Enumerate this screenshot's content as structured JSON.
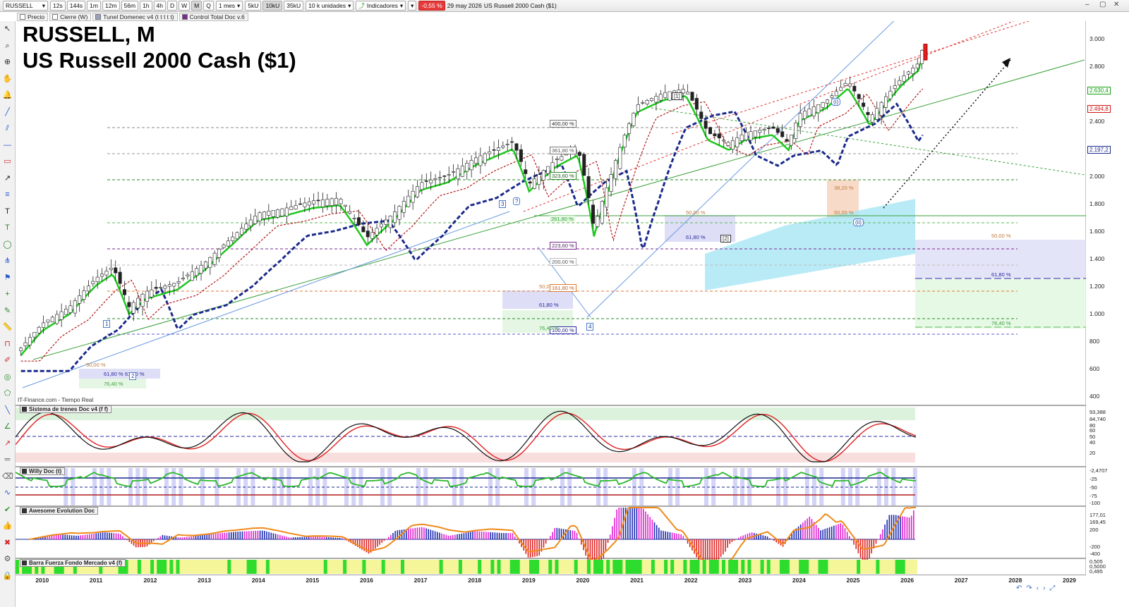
{
  "toolbar": {
    "symbol": "RUSSELL",
    "periods": [
      "12s",
      "144s",
      "1m",
      "12m",
      "56m",
      "1h",
      "4h",
      "D",
      "W",
      "M",
      "Q"
    ],
    "active_period": "M",
    "range": "1 mes",
    "volumes": [
      "5kU",
      "10kU",
      "35kU"
    ],
    "units": "10 k unidades",
    "indicators": "Indicadores",
    "change": "-0,55 %",
    "datetime": "29 may 2026",
    "instrument": "US Russell 2000 Cash ($1)"
  },
  "legend": [
    {
      "label": "Precio",
      "color": "#ffffff"
    },
    {
      "label": "Cierre (W)",
      "color": "#ffffff"
    },
    {
      "label": "Tunel Domenec v4 (t t t t t)",
      "color": "#9aa0b8"
    },
    {
      "label": "Control Total Doc v.6",
      "color": "#7a2a8c"
    }
  ],
  "title": {
    "main": "RUSSELL, M",
    "sub": "US Russell 2000 Cash ($1)"
  },
  "source": "IT-Finance.com - Tiempo Real",
  "y_axis": [
    "3.000",
    "2.800",
    "2.400",
    "2.000",
    "1.800",
    "1.600",
    "1.400",
    "1.200",
    "1.000",
    "800",
    "600",
    "400"
  ],
  "y_tags": [
    {
      "label": "2.630,4",
      "color": "#12a012"
    },
    {
      "label": "2.494,8",
      "color": "#d01515"
    },
    {
      "label": "2.197,2",
      "color": "#1b2a8c"
    }
  ],
  "x_axis": [
    "2010",
    "2011",
    "2012",
    "2013",
    "2014",
    "2015",
    "2016",
    "2017",
    "2018",
    "2019",
    "2020",
    "2021",
    "2022",
    "2023",
    "2024",
    "2025",
    "2026",
    "2027",
    "2028",
    "2029"
  ],
  "fib_labels": {
    "f400": "400,00 %",
    "f361": "361,80 %",
    "f323": "323,60 %",
    "f261": "261,80 %",
    "f223": "223,60 %",
    "f200": "200,00 %",
    "f161": "161,80 %",
    "f100": "100,00 %",
    "f50a": "50,00 %",
    "f61a": "61,80 %",
    "f50b": "50,00 %",
    "f61b": "61,80 %",
    "f764a": "76,40 %",
    "f50c": "50,00 %",
    "f61c": "61,80 %",
    "f50d": "50,00 %",
    "f382": "38,20 %",
    "f764b": "76,40 %",
    "f61d": "61,80 %",
    "f61e": "61,80 %",
    "f764c": "76,40 %",
    "f50e": "50,0"
  },
  "waves": {
    "w1": "1",
    "w2": "2",
    "w3": "3",
    "wq": "?",
    "w4": "4",
    "wI": "[1]",
    "wII": "[2]",
    "wi": "(i)",
    "wii": "(ii)"
  },
  "panels": {
    "trenes": {
      "title": "Sistema de trenes Doc v4 (f f)",
      "values": [
        "93,388",
        "84,740",
        "80",
        "60",
        "50",
        "40",
        "20"
      ]
    },
    "willy": {
      "title": "Willy Doc (t)",
      "values": [
        "-2,4707",
        "-25",
        "-50",
        "-75",
        "-100"
      ]
    },
    "awesome": {
      "title": "Awesome Evolution Doc",
      "values": [
        "177,01",
        "169,45",
        "200",
        "-200",
        "-400"
      ]
    },
    "barra": {
      "title": "Barra Fuerza Fondo Mercado v4 (f)",
      "values": [
        "0,505",
        "0,5000",
        "0,495"
      ]
    }
  },
  "chart_data": {
    "type": "candlestick",
    "title": "RUSSELL, M",
    "subtitle": "US Russell 2000 Cash ($1)",
    "ylim": [
      400,
      3100
    ],
    "y_scale": "log",
    "x_range": [
      2009.5,
      2029.3
    ],
    "close": [
      [
        2009.5,
        520
      ],
      [
        2010.0,
        620
      ],
      [
        2010.5,
        680
      ],
      [
        2011.0,
        800
      ],
      [
        2011.3,
        850
      ],
      [
        2011.6,
        680
      ],
      [
        2011.9,
        740
      ],
      [
        2012.5,
        780
      ],
      [
        2013.0,
        870
      ],
      [
        2013.5,
        1000
      ],
      [
        2014.0,
        1150
      ],
      [
        2014.5,
        1180
      ],
      [
        2015.0,
        1230
      ],
      [
        2015.5,
        1250
      ],
      [
        2016.0,
        1000
      ],
      [
        2016.5,
        1150
      ],
      [
        2017.0,
        1360
      ],
      [
        2017.5,
        1420
      ],
      [
        2018.0,
        1560
      ],
      [
        2018.7,
        1710
      ],
      [
        2019.0,
        1350
      ],
      [
        2019.5,
        1550
      ],
      [
        2019.9,
        1650
      ],
      [
        2020.2,
        1050
      ],
      [
        2020.5,
        1400
      ],
      [
        2021.0,
        2100
      ],
      [
        2021.5,
        2250
      ],
      [
        2021.9,
        2300
      ],
      [
        2022.3,
        1800
      ],
      [
        2022.7,
        1700
      ],
      [
        2023.0,
        1800
      ],
      [
        2023.5,
        1850
      ],
      [
        2023.8,
        1700
      ],
      [
        2024.0,
        2000
      ],
      [
        2024.5,
        2150
      ],
      [
        2024.9,
        2400
      ],
      [
        2025.3,
        1950
      ],
      [
        2025.6,
        2200
      ],
      [
        2025.9,
        2450
      ],
      [
        2026.2,
        2650
      ],
      [
        2026.3,
        2950
      ]
    ]
  }
}
